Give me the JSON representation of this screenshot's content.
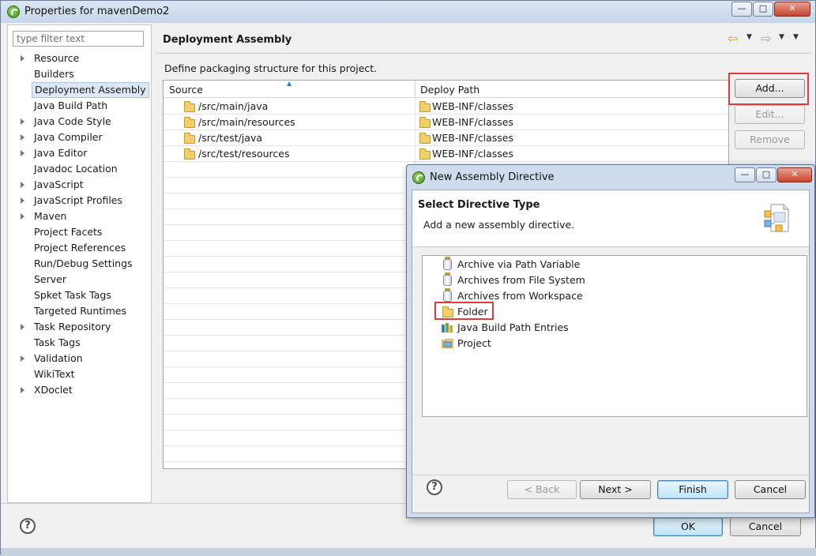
{
  "window": {
    "title": "Properties for mavenDemo2",
    "minimize_glyph": "—",
    "maximize_glyph": "□",
    "close_glyph": "✕"
  },
  "filter": {
    "placeholder": "type filter text"
  },
  "tree": {
    "items": [
      {
        "label": "Resource",
        "expandable": true
      },
      {
        "label": "Builders",
        "expandable": false
      },
      {
        "label": "Deployment Assembly",
        "expandable": false,
        "selected": true
      },
      {
        "label": "Java Build Path",
        "expandable": false
      },
      {
        "label": "Java Code Style",
        "expandable": true
      },
      {
        "label": "Java Compiler",
        "expandable": true
      },
      {
        "label": "Java Editor",
        "expandable": true
      },
      {
        "label": "Javadoc Location",
        "expandable": false
      },
      {
        "label": "JavaScript",
        "expandable": true
      },
      {
        "label": "JavaScript Profiles",
        "expandable": true
      },
      {
        "label": "Maven",
        "expandable": true
      },
      {
        "label": "Project Facets",
        "expandable": false
      },
      {
        "label": "Project References",
        "expandable": false
      },
      {
        "label": "Run/Debug Settings",
        "expandable": false
      },
      {
        "label": "Server",
        "expandable": false
      },
      {
        "label": "Spket Task Tags",
        "expandable": false
      },
      {
        "label": "Targeted Runtimes",
        "expandable": false
      },
      {
        "label": "Task Repository",
        "expandable": true
      },
      {
        "label": "Task Tags",
        "expandable": false
      },
      {
        "label": "Validation",
        "expandable": true
      },
      {
        "label": "WikiText",
        "expandable": false
      },
      {
        "label": "XDoclet",
        "expandable": true
      }
    ]
  },
  "page": {
    "title": "Deployment Assembly",
    "description": "Define packaging structure for this project."
  },
  "table": {
    "columns": [
      "Source",
      "Deploy Path"
    ],
    "rows": [
      {
        "source": "/src/main/java",
        "deploy": "WEB-INF/classes"
      },
      {
        "source": "/src/main/resources",
        "deploy": "WEB-INF/classes"
      },
      {
        "source": "/src/test/java",
        "deploy": "WEB-INF/classes"
      },
      {
        "source": "/src/test/resources",
        "deploy": "WEB-INF/classes"
      }
    ]
  },
  "buttons": {
    "add": "Add...",
    "edit": "Edit...",
    "remove": "Remove",
    "ok": "OK",
    "cancel": "Cancel"
  },
  "dialog": {
    "title": "New Assembly Directive",
    "heading": "Select Directive Type",
    "subheading": "Add a new assembly directive.",
    "items": [
      {
        "label": "Archive via Path Variable",
        "icon": "jar-icon"
      },
      {
        "label": "Archives from File System",
        "icon": "jar-icon"
      },
      {
        "label": "Archives from Workspace",
        "icon": "jar-icon"
      },
      {
        "label": "Folder",
        "icon": "folder-icon",
        "highlighted": true
      },
      {
        "label": "Java Build Path Entries",
        "icon": "library-icon"
      },
      {
        "label": "Project",
        "icon": "project-icon"
      }
    ],
    "buttons": {
      "back": "< Back",
      "next": "Next >",
      "finish": "Finish",
      "cancel": "Cancel"
    }
  },
  "colors": {
    "highlight_box": "#e03b3b",
    "selection": "#dce8f5",
    "default_button": "#3c7fb1"
  }
}
